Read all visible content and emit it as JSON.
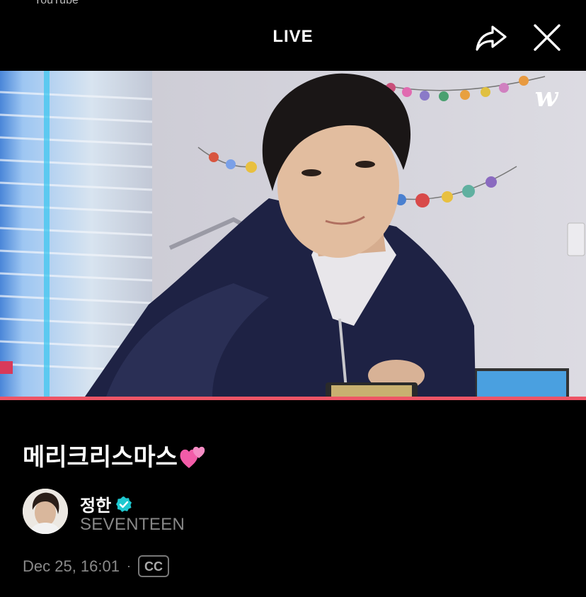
{
  "status_bar": {
    "partial_text": "YouTube"
  },
  "header": {
    "title": "LIVE"
  },
  "video": {
    "progress": 1.0,
    "watermark": "w",
    "accent_color": "#ee5566"
  },
  "post": {
    "title": "메리크리스마스",
    "title_emoji": "two-hearts-icon"
  },
  "channel": {
    "name": "정한",
    "verified": true,
    "artist": "SEVENTEEN"
  },
  "meta": {
    "date": "Dec 25, 16:01",
    "separator": "·",
    "cc_label": "CC"
  }
}
